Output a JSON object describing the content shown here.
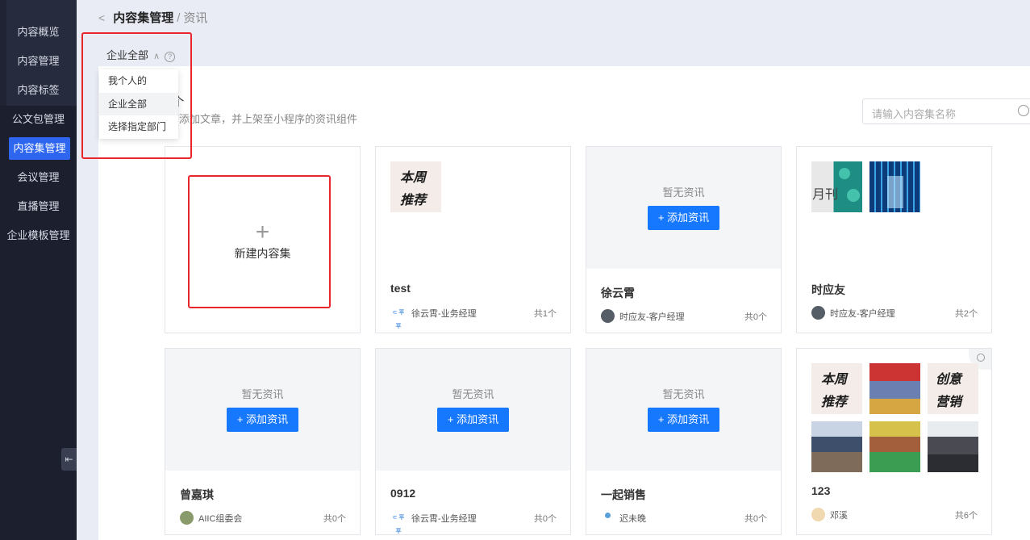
{
  "sidebar": {
    "items": [
      {
        "label": "内容概览"
      },
      {
        "label": "内容管理"
      },
      {
        "label": "内容标签"
      },
      {
        "label": "公文包管理"
      },
      {
        "label": "内容集管理",
        "active": true
      },
      {
        "label": "会议管理"
      },
      {
        "label": "直播管理"
      },
      {
        "label": "企业模板管理"
      }
    ],
    "collapse_glyph": "⇤"
  },
  "breadcrumb": {
    "back": "<",
    "current": "内容集管理",
    "separator": "/",
    "leaf": "资讯"
  },
  "scope_filter": {
    "label": "企业全部",
    "chevron": "∧",
    "help": "?",
    "options": [
      {
        "label": "我个人的"
      },
      {
        "label": "企业全部",
        "selected": true
      },
      {
        "label": "选择指定部门"
      }
    ]
  },
  "header_fragments": {
    "count_suffix": "0个",
    "description_suffix": "可添加文章，并上架至小程序的资讯组件"
  },
  "search": {
    "placeholder": "请输入内容集名称"
  },
  "create_card": {
    "plus": "+",
    "label": "新建内容集"
  },
  "cards": [
    {
      "name": "test",
      "owner": "徐云霄-业务经理",
      "count": "共1个",
      "thumbs": [
        "weekly-recommend"
      ],
      "weekly_line1": "本周",
      "weekly_line2": "推荐"
    },
    {
      "name": "徐云霄",
      "owner": "时应友-客户经理",
      "count": "共0个",
      "empty_text": "暂无资讯",
      "add_label": "+ 添加资讯"
    },
    {
      "name": "时应友",
      "owner": "时应友-客户经理",
      "count": "共2个",
      "month_text": "月刊"
    },
    {
      "name": "曾嘉琪",
      "owner": "AIIC组委会",
      "count": "共0个",
      "empty_text": "暂无资讯",
      "add_label": "+ 添加资讯"
    },
    {
      "name": "0912",
      "owner": "徐云霄-业务经理",
      "count": "共0个",
      "empty_text": "暂无资讯",
      "add_label": "+ 添加资讯"
    },
    {
      "name": "一起销售",
      "owner": "迟未晚",
      "count": "共0个",
      "empty_text": "暂无资讯",
      "add_label": "+ 添加资讯"
    },
    {
      "name": "123",
      "owner": "邓溪",
      "count": "共6个",
      "weekly_line1": "本周",
      "weekly_line2": "推荐",
      "creative_line1": "创意",
      "creative_line2": "营销"
    }
  ],
  "owner_logo_text": "⊂ 平平",
  "colors": {
    "accent": "#1677ff",
    "sidebar_bg": "#1f2333",
    "highlight": "#e8262c"
  }
}
